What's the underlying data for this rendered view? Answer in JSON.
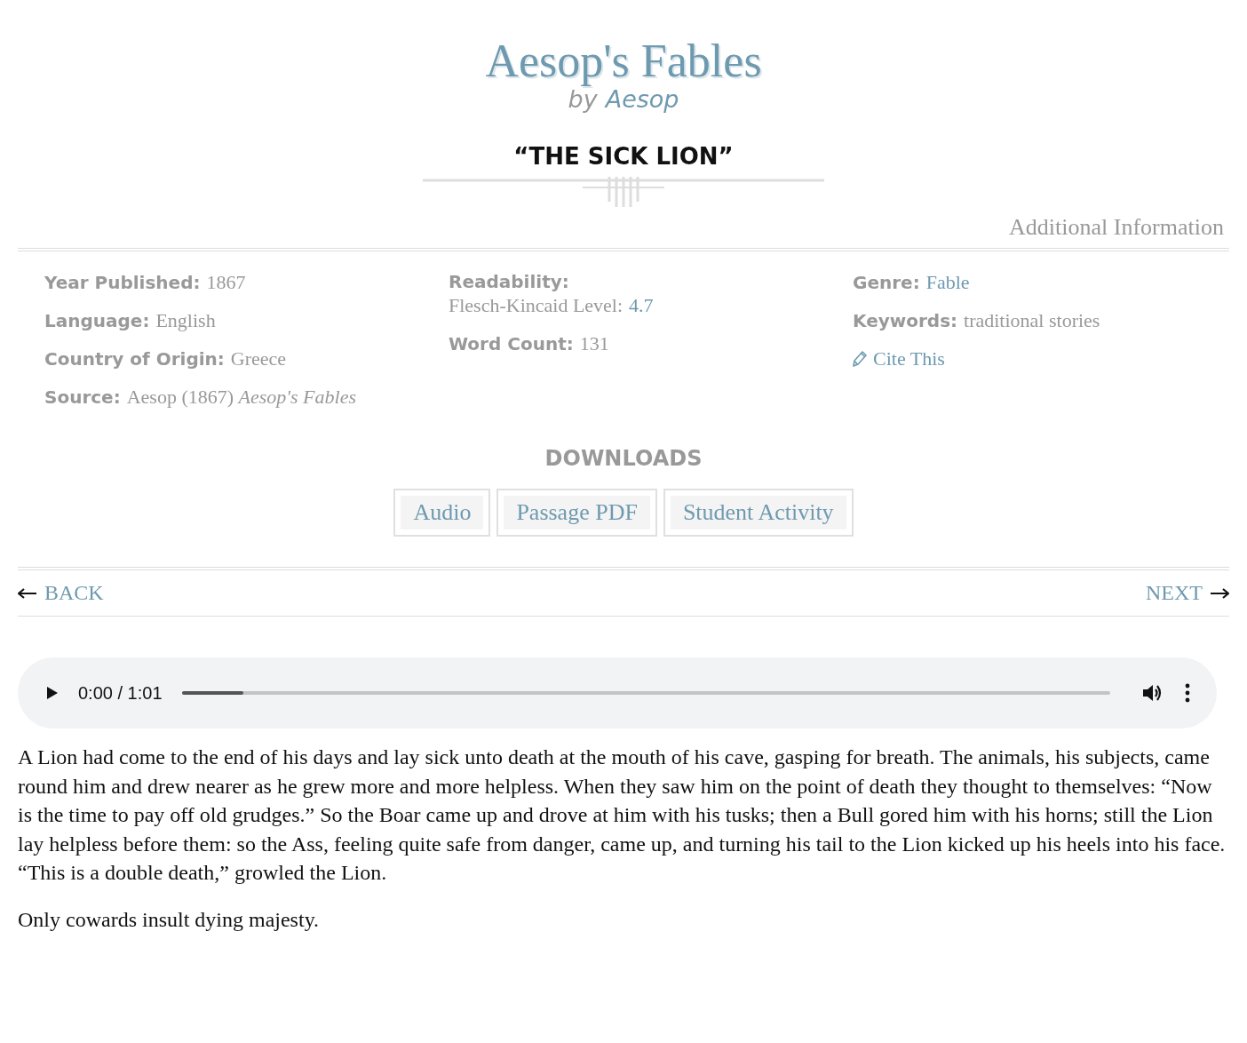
{
  "site_title": "Aesop's Fables",
  "byline": {
    "prefix": "by",
    "author": "Aesop"
  },
  "story_title": "“THE SICK LION”",
  "additional_info_heading": "Additional Information",
  "info_columns": [
    {
      "items": [
        {
          "kind": "plain",
          "label": "Year Published:",
          "value": "1867"
        },
        {
          "kind": "plain",
          "label": "Language:",
          "value": "English"
        },
        {
          "kind": "plain",
          "label": "Country of Origin:",
          "value": "Greece"
        },
        {
          "kind": "plain",
          "label": "Source:",
          "value": "Aesop (1867) *Aesop's Fables*"
        }
      ]
    },
    {
      "items": [
        {
          "kind": "block",
          "label": "Readability:",
          "value": "Flesch-Kincaid Level:",
          "link": "4.7"
        },
        {
          "kind": "plain",
          "label": "Word Count:",
          "value": "131"
        }
      ]
    },
    {
      "items": [
        {
          "kind": "link",
          "label": "Genre:",
          "link": "Fable"
        },
        {
          "kind": "plain",
          "label": "Keywords:",
          "value": "traditional stories"
        },
        {
          "kind": "cite",
          "link": "Cite This"
        }
      ]
    }
  ],
  "downloads": {
    "heading": "DOWNLOADS",
    "buttons": [
      "Audio",
      "Passage PDF",
      "Student Activity"
    ]
  },
  "nav": {
    "back": "BACK",
    "next": "NEXT"
  },
  "audio": {
    "time": "0:00 / 1:01",
    "level": 0.066
  },
  "paragraphs": [
    "A Lion had come to the end of his days and lay sick unto death at the mouth of his cave, gasping for breath. The animals, his subjects, came round him and drew nearer as he grew more and more helpless. When they saw him on the point of death they thought to themselves: “Now is the time to pay off old grudges.” So the Boar came up and drove at him with his tusks; then a Bull gored him with his horns; still the Lion lay helpless before them: so the Ass, feeling quite safe from danger, came up, and turning his tail to the Lion kicked up his heels into his face. “This is a double death,” growled the Lion.",
    "Only cowards insult dying majesty."
  ]
}
